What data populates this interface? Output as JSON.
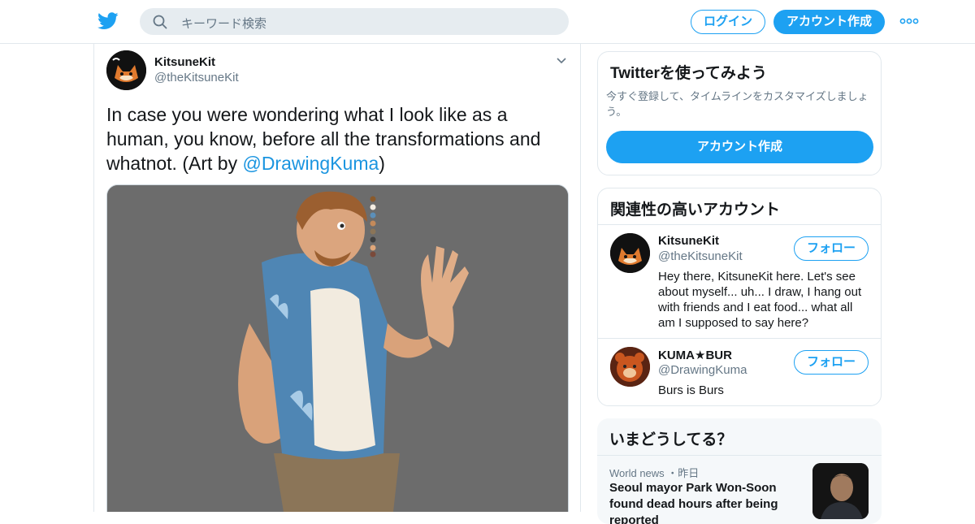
{
  "header": {
    "search_placeholder": "キーワード検索",
    "login_label": "ログイン",
    "signup_label": "アカウント作成"
  },
  "tweet": {
    "author_name": "KitsuneKit",
    "author_handle": "@theKitsuneKit",
    "text_before": "In case you were wondering what I look like as a human, you know, before all the transformations and whatnot. (Art by ",
    "mention": "@DrawingKuma",
    "text_after": ")"
  },
  "signup_card": {
    "title": "Twitterを使ってみよう",
    "description": "今すぐ登録して、タイムラインをカスタマイズしましょう。",
    "cta_label": "アカウント作成"
  },
  "related_accounts": {
    "title": "関連性の高いアカウント",
    "accounts": [
      {
        "name": "KitsuneKit",
        "handle": "@theKitsuneKit",
        "bio": "Hey there, KitsuneKit here. Let's see about myself... uh... I draw, I hang out with friends and I eat food... what all am I supposed to say here?",
        "follow_label": "フォロー"
      },
      {
        "name": "KUMA★BUR",
        "handle": "@DrawingKuma",
        "bio": "Burs is Burs",
        "follow_label": "フォロー"
      }
    ]
  },
  "trends": {
    "title": "いまどうしてる？",
    "items": [
      {
        "meta": "World news ・昨日",
        "headline": "Seoul mayor Park Won-Soon found dead hours after being reported"
      }
    ]
  },
  "colors": {
    "accent": "#1da1f2",
    "mention": "#1b95e0",
    "secondary_text": "#657786",
    "border": "#e1e8ed"
  }
}
